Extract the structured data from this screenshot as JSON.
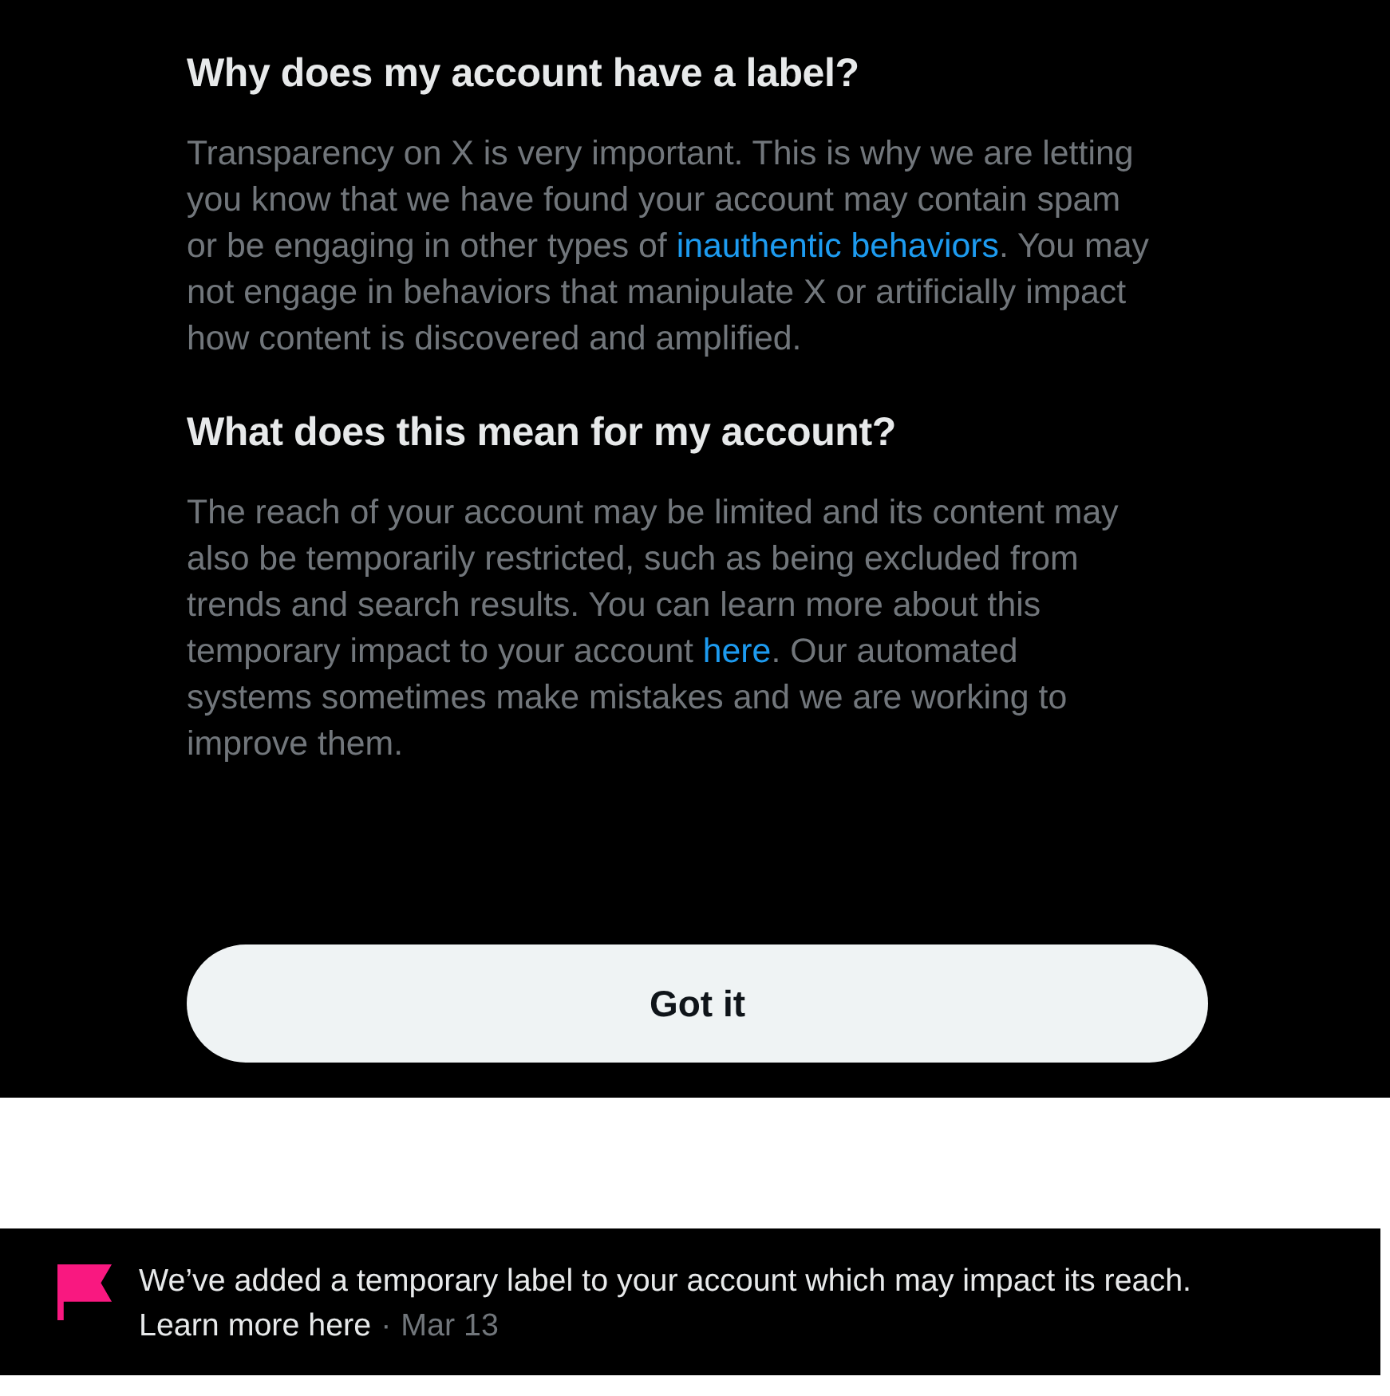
{
  "dialog": {
    "sections": [
      {
        "heading": "Why does my account have a label?",
        "body": [
          {
            "kind": "text",
            "text": "Transparency on X is very important. This is why we are letting you know that we have found your account may contain spam or be engaging in other types of "
          },
          {
            "kind": "link",
            "text": "inauthentic behaviors"
          },
          {
            "kind": "text",
            "text": ". You may not engage in behaviors that manipulate X or artificially impact how content is discovered and amplified."
          }
        ]
      },
      {
        "heading": "What does this mean for my account?",
        "body": [
          {
            "kind": "text",
            "text": "The reach of your account may be limited and its content may also be temporarily restricted, such as being excluded from trends and search results. You can learn more about this temporary impact to your account "
          },
          {
            "kind": "link",
            "text": "here"
          },
          {
            "kind": "text",
            "text": ". Our automated systems sometimes make mistakes and we are working to improve them."
          }
        ]
      }
    ],
    "button": {
      "label": "Got it"
    }
  },
  "notice": {
    "message": "We’ve added a temporary label to your account which may impact its reach.",
    "link": "Learn more here",
    "separator": "·",
    "date": "Mar 13"
  }
}
